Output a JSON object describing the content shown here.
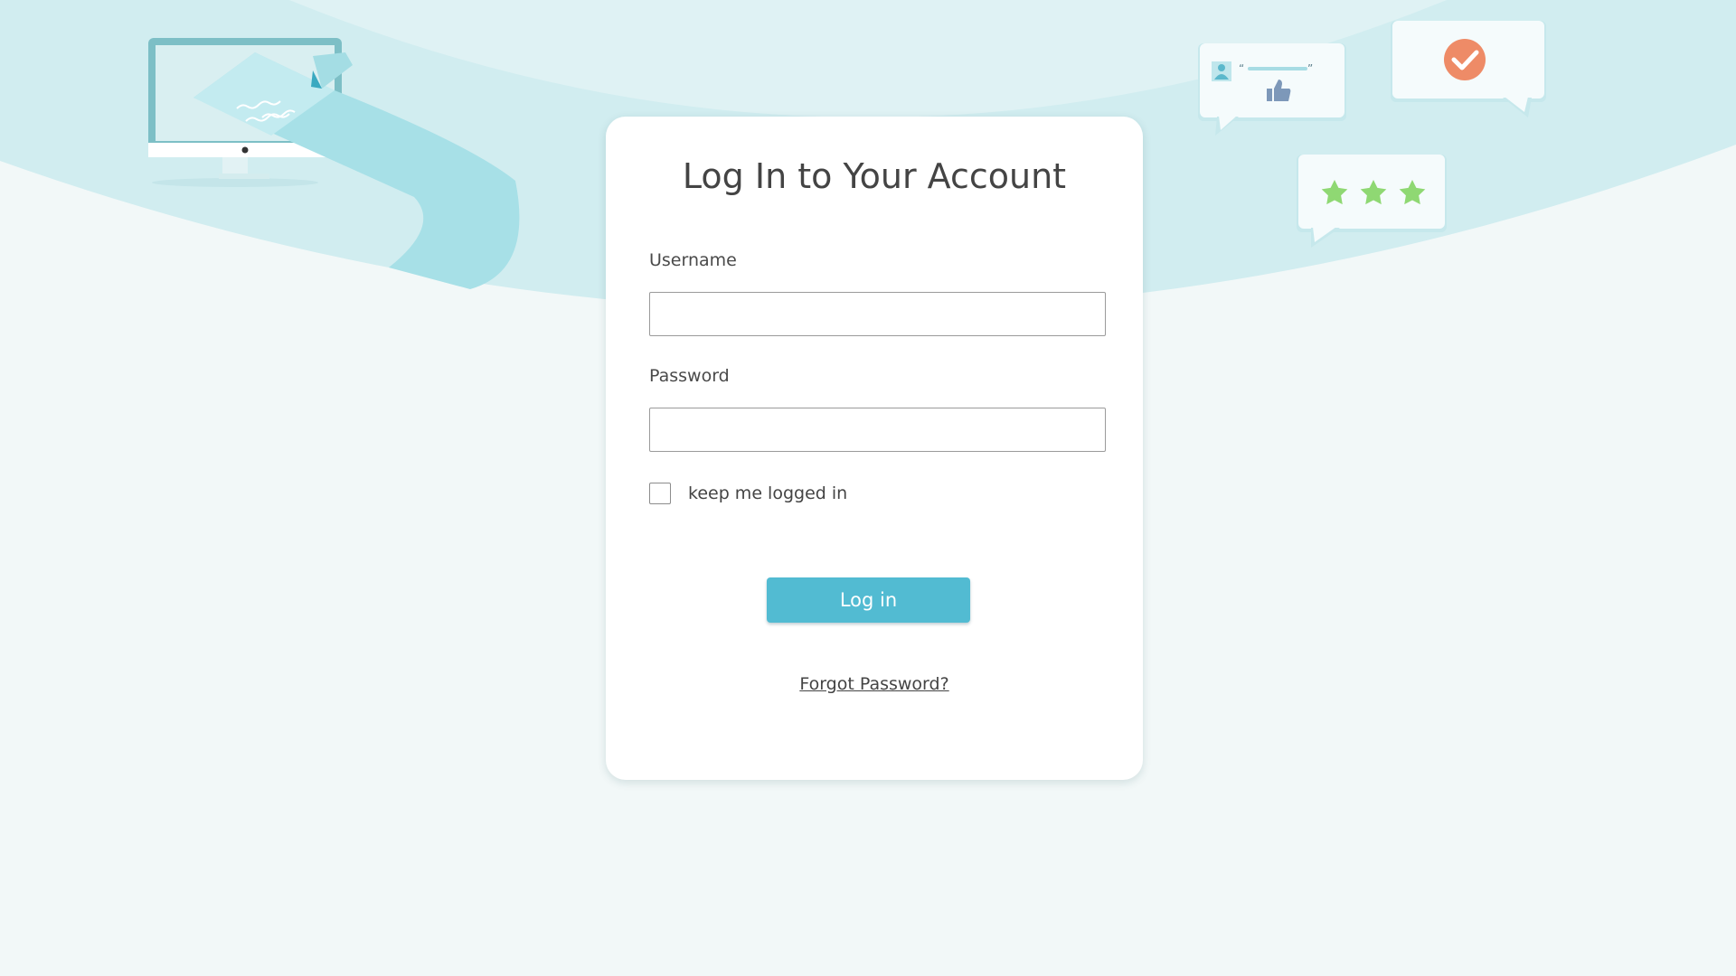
{
  "login": {
    "title": "Log In to Your Account",
    "username_label": "Username",
    "username_value": "",
    "password_label": "Password",
    "password_value": "",
    "remember_label": "keep me logged in",
    "remember_checked": false,
    "submit_label": "Log in",
    "forgot_link": "Forgot Password?"
  },
  "decorations": {
    "rating_stars": 3,
    "icons": [
      "monitor-icon",
      "pencil-icon",
      "user-icon",
      "thumbs-up-icon",
      "check-circle-icon",
      "star-icon"
    ]
  },
  "colors": {
    "page_background": "#f2f8f8",
    "header_wave": "#d1edf0",
    "header_wave_light": "#dff2f4",
    "card_background": "#ffffff",
    "button": "#52bbd2",
    "button_text": "#ffffff",
    "text": "#444444",
    "check_badge": "#ee8b67",
    "star": "#8fd873"
  }
}
